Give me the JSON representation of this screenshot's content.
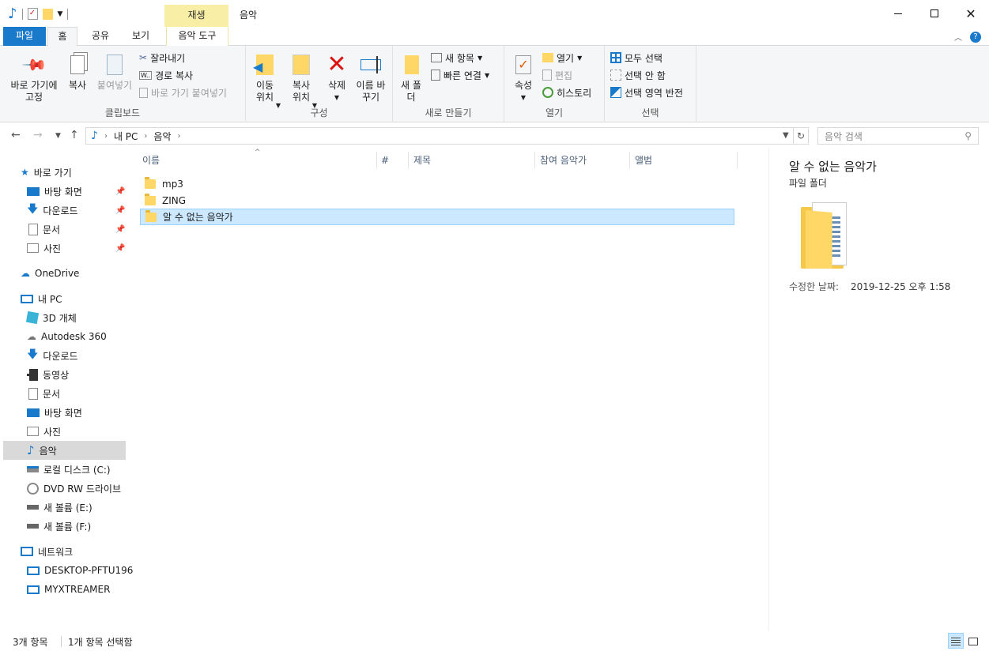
{
  "window": {
    "context_tab": "재생",
    "title": "음악"
  },
  "ribbon_tabs": {
    "file": "파일",
    "home": "홈",
    "share": "공유",
    "view": "보기",
    "music_tools": "음악 도구"
  },
  "ribbon": {
    "clipboard": {
      "pin_label": "바로 가기에 고정",
      "copy_label": "복사",
      "paste_label": "붙여넣기",
      "cut_label": "잘라내기",
      "copy_path_label": "경로 복사",
      "paste_shortcut_label": "바로 가기 붙여넣기",
      "group_label": "클립보드"
    },
    "organize": {
      "move_to_label": "이동 위치",
      "copy_to_label": "복사 위치",
      "delete_label": "삭제",
      "rename_label": "이름 바꾸기",
      "group_label": "구성"
    },
    "new": {
      "new_folder_label": "새 폴더",
      "new_item_label": "새 항목",
      "easy_access_label": "빠른 연결",
      "group_label": "새로 만들기"
    },
    "open": {
      "properties_label": "속성",
      "open_label": "열기",
      "edit_label": "편집",
      "history_label": "히스토리",
      "group_label": "열기"
    },
    "select": {
      "select_all_label": "모두 선택",
      "select_none_label": "선택 안 함",
      "invert_label": "선택 영역 반전",
      "group_label": "선택"
    }
  },
  "address": {
    "crumbs": [
      "내 PC",
      "음악"
    ],
    "search_placeholder": "음악 검색"
  },
  "nav": {
    "quick_access": "바로 가기",
    "quick_items": [
      "바탕 화면",
      "다운로드",
      "문서",
      "사진"
    ],
    "onedrive": "OneDrive",
    "this_pc": "내 PC",
    "pc_items": [
      "3D 개체",
      "Autodesk 360",
      "다운로드",
      "동영상",
      "문서",
      "바탕 화면",
      "사진",
      "음악",
      "로컬 디스크 (C:)",
      "DVD RW 드라이브",
      "새 볼륨 (E:)",
      "새 볼륨 (F:)"
    ],
    "network": "네트워크",
    "network_items": [
      "DESKTOP-PFTU196",
      "MYXTREAMER"
    ]
  },
  "columns": [
    "이름",
    "#",
    "제목",
    "참여 음악가",
    "앨범"
  ],
  "files": [
    {
      "name": "mp3",
      "selected": false
    },
    {
      "name": "ZING",
      "selected": false
    },
    {
      "name": "알 수 없는 음악가",
      "selected": true
    }
  ],
  "details": {
    "title": "알 수 없는 음악가",
    "type": "파일 폴더",
    "modified_label": "수정한 날짜:",
    "modified_value": "2019-12-25 오후 1:58"
  },
  "status": {
    "count": "3개 항목",
    "selected": "1개 항목 선택함"
  },
  "colors": {
    "accent": "#1979ca",
    "selection": "#cce8ff",
    "folder": "#ffd766"
  }
}
